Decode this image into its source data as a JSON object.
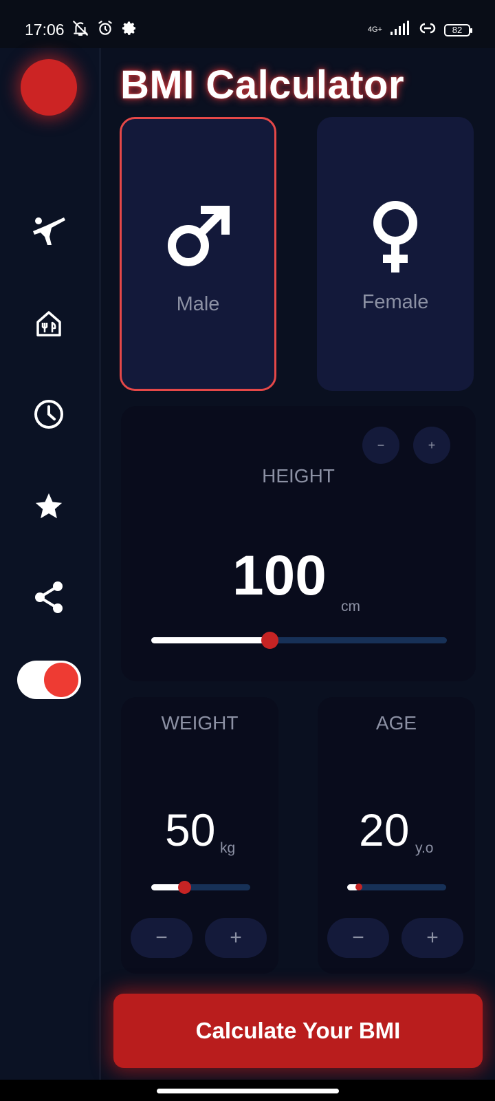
{
  "status_bar": {
    "time": "17:06",
    "network": "4G+",
    "battery": "82"
  },
  "app": {
    "title": "BMI Calculator"
  },
  "sidebar": {
    "items": [
      {
        "icon": "martial-arts-icon"
      },
      {
        "icon": "restaurant-icon"
      },
      {
        "icon": "clock-icon"
      },
      {
        "icon": "star-icon"
      },
      {
        "icon": "share-icon"
      }
    ],
    "toggle_on": true
  },
  "gender": {
    "male_label": "Male",
    "female_label": "Female",
    "selected": "male"
  },
  "height": {
    "label": "HEIGHT",
    "value": "100",
    "unit": "cm",
    "minus": "−",
    "plus": "+",
    "slider_fraction": 0.4
  },
  "weight": {
    "label": "WEIGHT",
    "value": "50",
    "unit": "kg",
    "minus": "−",
    "plus": "+",
    "slider_fraction": 0.33
  },
  "age": {
    "label": "AGE",
    "value": "20",
    "unit": "y.o",
    "minus": "−",
    "plus": "+",
    "slider_fraction": 0.12
  },
  "calculate_button": {
    "label": "Calculate Your BMI"
  },
  "colors": {
    "accent": "#c62424",
    "card": "#13193a",
    "panel": "#090c1c",
    "track": "#173157"
  }
}
